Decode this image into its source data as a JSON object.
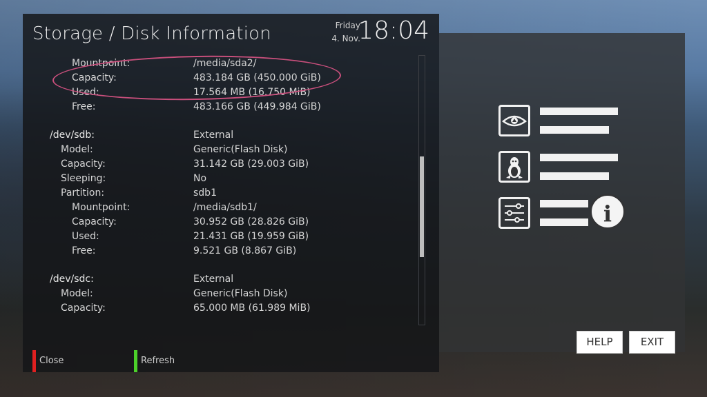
{
  "header": {
    "title": "Storage / Disk Information",
    "day": "Friday",
    "date": "4. Nov.",
    "time": "18:04"
  },
  "rows": [
    {
      "label": "Mountpoint:",
      "value": "/media/sda2/"
    },
    {
      "label": "Capacity:",
      "value": "483.184 GB  (450.000 GiB)"
    },
    {
      "label": "Used:",
      "value": "17.564 MB  (16.750 MiB)"
    },
    {
      "label": "Free:",
      "value": "483.166 GB  (449.984 GiB)"
    },
    {
      "label": "/dev/sdb:",
      "value": "External"
    },
    {
      "label": "Model:",
      "value": "Generic(Flash Disk)"
    },
    {
      "label": "Capacity:",
      "value": "31.142 GB  (29.003 GiB)"
    },
    {
      "label": "Sleeping:",
      "value": "No"
    },
    {
      "label": "Partition:",
      "value": "sdb1"
    },
    {
      "label": "Mountpoint:",
      "value": "/media/sdb1/"
    },
    {
      "label": "Capacity:",
      "value": "30.952 GB  (28.826 GiB)"
    },
    {
      "label": "Used:",
      "value": "21.431 GB  (19.959 GiB)"
    },
    {
      "label": "Free:",
      "value": "9.521 GB  (8.867 GiB)"
    },
    {
      "label": "/dev/sdc:",
      "value": "External"
    },
    {
      "label": "Model:",
      "value": "Generic(Flash Disk)"
    },
    {
      "label": "Capacity:",
      "value": "65.000 MB  (61.989 MiB)"
    }
  ],
  "footer": {
    "red_label": "Close",
    "green_label": "Refresh",
    "red_color": "#e02020",
    "green_color": "#4cd12a"
  },
  "buttons": {
    "help": "HELP",
    "exit": "EXIT"
  },
  "icons": {
    "row1": "eye-icon",
    "row2": "linux-penguin-icon",
    "row3": "sliders-icon",
    "info": "info-icon"
  },
  "colors": {
    "highlight": "#c94f7c"
  }
}
